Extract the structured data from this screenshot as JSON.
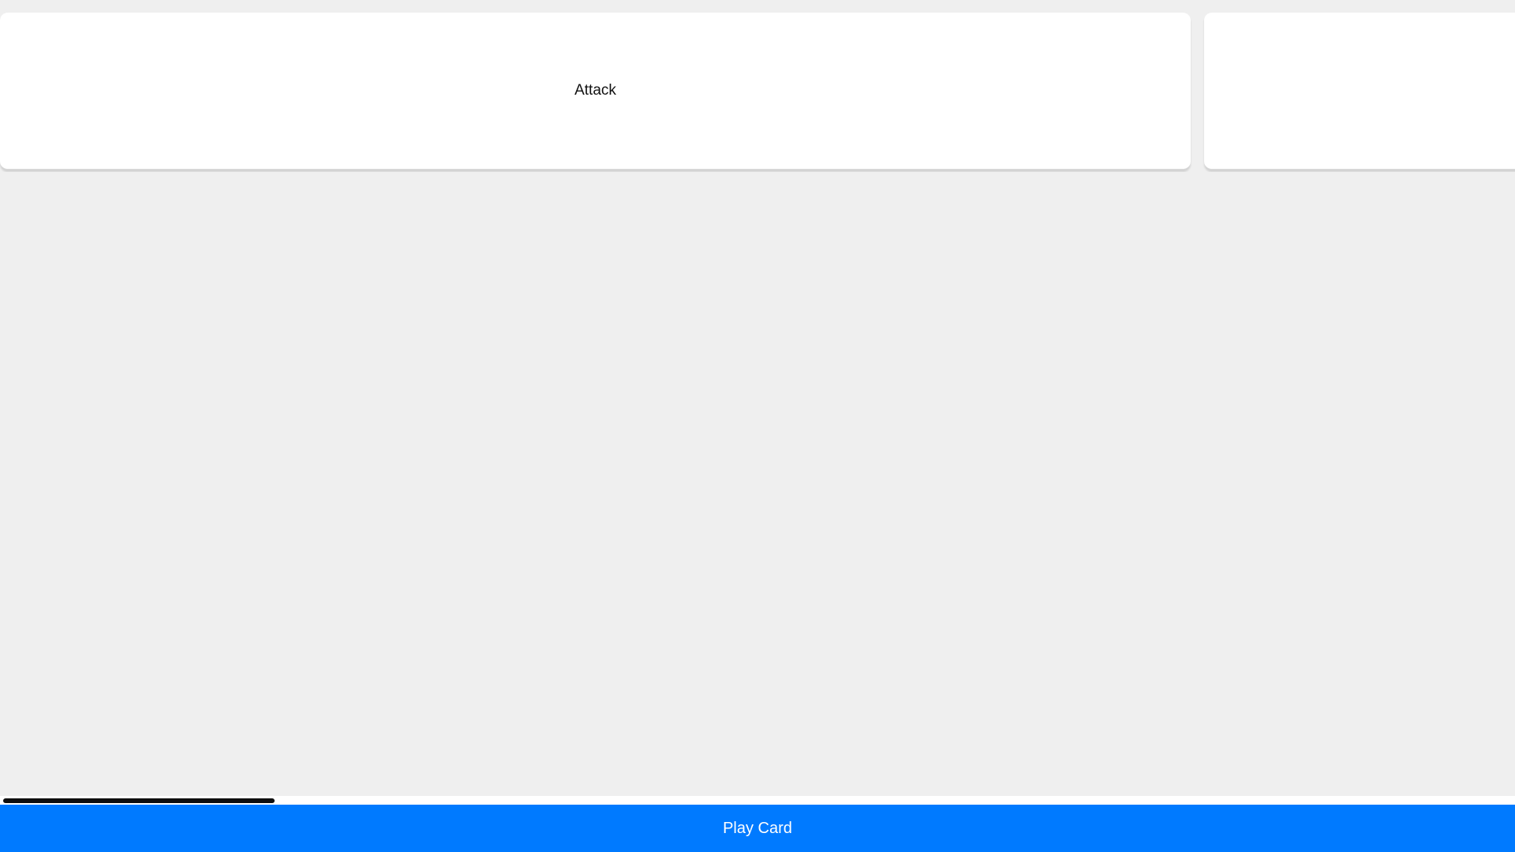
{
  "hand": {
    "cards": [
      {
        "label": "Attack"
      },
      {
        "label": ""
      }
    ],
    "scroll_fraction_visible": 0.18
  },
  "actions": {
    "play_label": "Play Card"
  },
  "colors": {
    "background": "#efefef",
    "card": "#ffffff",
    "accent": "#007aff",
    "scroll_thumb": "#0e0e0e"
  }
}
